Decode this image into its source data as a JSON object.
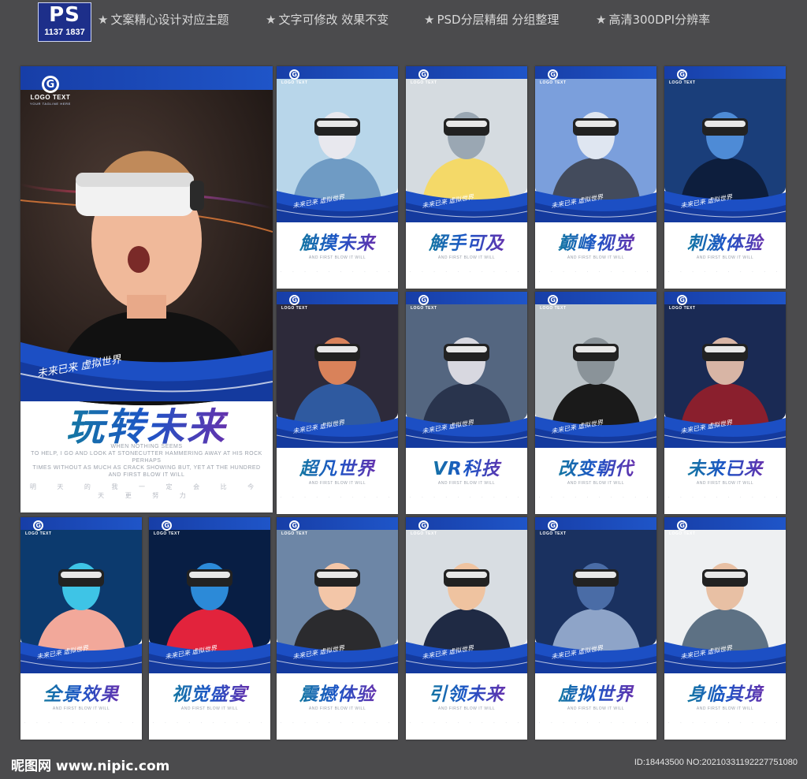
{
  "header": {
    "badge_title": "PS",
    "badge_number": "1137 1837",
    "features": [
      "文案精心设计对应主题",
      "文字可修改 效果不变",
      "PSD分层精细 分组整理",
      "高清300DPI分辨率"
    ],
    "star": "★"
  },
  "logo": {
    "mark": "G",
    "text": "LOGO TEXT",
    "tagline": "YOUR TAGLINE HERE"
  },
  "slogan": "未来已来 虚拟世界",
  "main_poster": {
    "title": "玩转未来",
    "subtitle_lines": [
      "WHEN NOTHING SEEMS",
      "TO HELP, I GO AND LOOK AT STONECUTTER HAMMERING AWAY AT HIS ROCK PERHAPS",
      "TIMES WITHOUT AS MUCH AS CRACK SHOWING BUT, YET AT THE HUNDRED",
      "AND FIRST BLOW IT WILL"
    ],
    "dots": "明 天 的 我 一 定 会 比 今 天 更 努 力"
  },
  "posters": [
    {
      "title": "触摸未来"
    },
    {
      "title": "解手可及"
    },
    {
      "title": "巅峰视觉"
    },
    {
      "title": "刺激体验"
    },
    {
      "title": "超凡世界"
    },
    {
      "title": "VR科技"
    },
    {
      "title": "改变朝代"
    },
    {
      "title": "未来已来"
    },
    {
      "title": "全景效果"
    },
    {
      "title": "视觉盛宴"
    },
    {
      "title": "震撼体验"
    },
    {
      "title": "引领未来"
    },
    {
      "title": "虚拟世界"
    },
    {
      "title": "身临其境"
    }
  ],
  "small_sub": "AND FIRST BLOW IT WILL",
  "small_dots": "· · · · · · · · · ·",
  "footer": {
    "site": "昵图网 www.nipic.com",
    "id_text": "ID:18443500 NO:20210331192227751080"
  },
  "colors": {
    "blue": "#1f4fc2",
    "dark_blue": "#143a9e",
    "teal": "#0f8b8d",
    "purple": "#8b1fa0"
  }
}
